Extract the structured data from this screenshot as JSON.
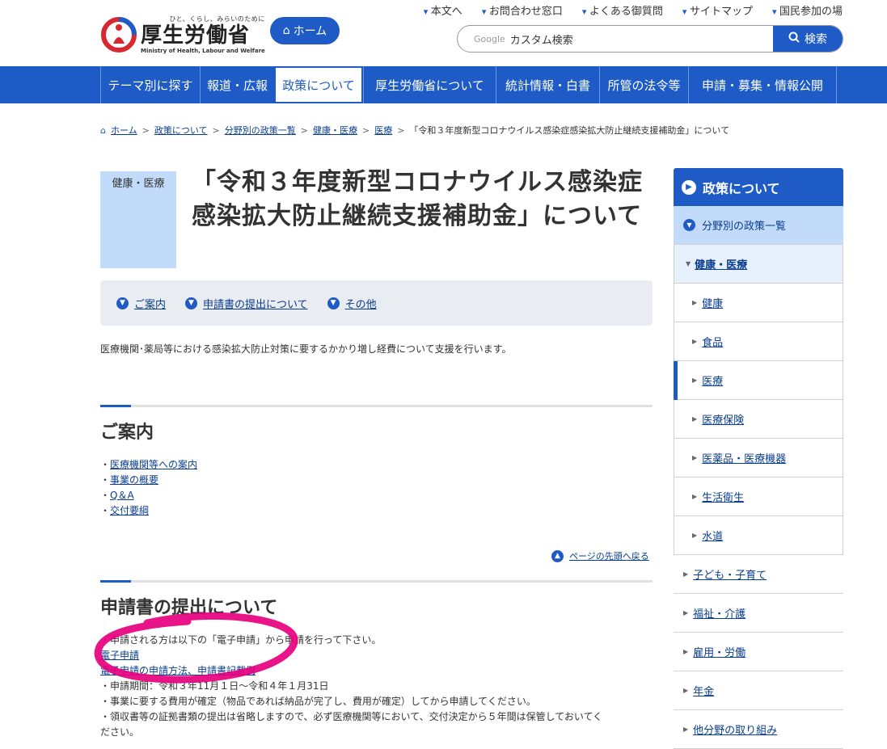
{
  "header": {
    "logo_tagline": "ひと、くらし、みらいのために",
    "logo_name": "厚生労働省",
    "logo_en": "Ministry of Health, Labour and Welfare",
    "home_label": "ホーム",
    "util_links": [
      "本文へ",
      "お問合わせ窓口",
      "よくある御質問",
      "サイトマップ",
      "国民参加の場"
    ],
    "search_brand": "Google",
    "search_placeholder": "カスタム検索",
    "search_button": "検索"
  },
  "gnav": {
    "items": [
      "テーマ別に探す",
      "報道・広報",
      "政策について",
      "厚生労働省について",
      "統計情報・白書",
      "所管の法令等",
      "申請・募集・情報公開"
    ],
    "active": "政策について"
  },
  "breadcrumb": [
    "ホーム",
    "政策について",
    "分野別の政策一覧",
    "健康・医療",
    "医療",
    "「令和３年度新型コロナウイルス感染症感染拡大防止継続支援補助金」について"
  ],
  "page": {
    "category": "健康・医療",
    "title": "「令和３年度新型コロナウイルス感染症感染拡大防止継続支援補助金」について",
    "anchors": [
      "ご案内",
      "申請書の提出について",
      "その他"
    ],
    "lead": "医療機関･薬局等における感染拡大防止対策に要するかかり増し経費について支援を行います。"
  },
  "section1": {
    "heading": "ご案内",
    "links": [
      "医療機関等への案内",
      "事業の概要",
      "Q＆A",
      "交付要綱"
    ],
    "pagetop": "ページの先頭へ戻る"
  },
  "section2": {
    "heading": "申請書の提出について",
    "lines": [
      "申請される方は以下の「電子申請」から申請を行って下さい。",
      "電子申請",
      "電子申請の申請方法、申請書記載例",
      "申請期間：令和３年11月１日〜令和４年１月31日",
      "事業に要する費用が確定（物品であれば納品が完了し、費用が確定）してから申請してください。",
      "領収書等の証拠書類の提出は省略しますので、必ず医療機関等において、交付決定から５年間は保管しておいてく",
      "ださい。"
    ]
  },
  "sidebar": {
    "head": "政策について",
    "sub": "分野別の政策一覧",
    "current": "健康・医療",
    "children": [
      "健康",
      "食品",
      "医療",
      "医療保険",
      "医薬品・医療機器",
      "生活衛生",
      "水道"
    ],
    "selected": "医療",
    "others": [
      "子ども・子育て",
      "福祉・介護",
      "雇用・労働",
      "年金",
      "他分野の取り組み"
    ]
  },
  "colors": {
    "brand": "#1e5bc6",
    "highlight": "#e6007e",
    "category_bg": "#c2dbfb"
  }
}
